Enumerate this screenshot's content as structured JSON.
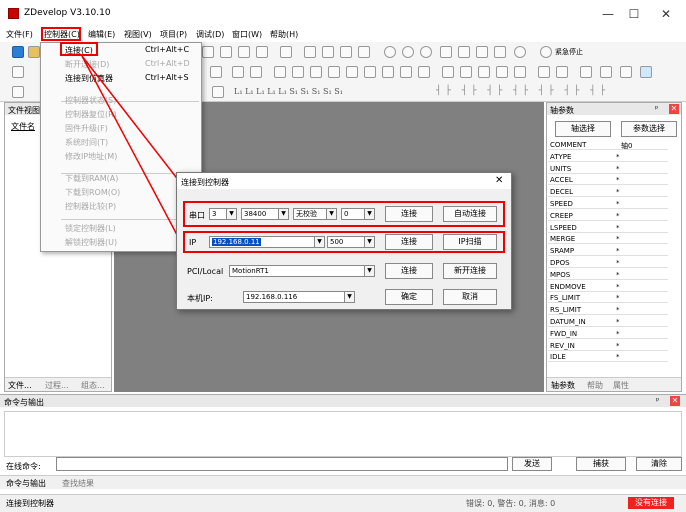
{
  "app": {
    "title": "ZDevelop V3.10.10"
  },
  "window_controls": {
    "minimize": "—",
    "maximize": "☐",
    "close": "✕"
  },
  "menubar": [
    {
      "label": "文件(F)"
    },
    {
      "label": "控制器(C)"
    },
    {
      "label": "编辑(E)"
    },
    {
      "label": "视图(V)"
    },
    {
      "label": "项目(P)"
    },
    {
      "label": "调试(D)"
    },
    {
      "label": "窗口(W)"
    },
    {
      "label": "帮助(H)"
    }
  ],
  "toolbar": {
    "emergency_stop": "紧急停止",
    "font_row": "L₁ L₁ L₁ L₁ L₁  S₁ S₁ S₁ S₁ S₁"
  },
  "controller_menu": {
    "items": [
      {
        "label": "连接(C)",
        "shortcut": "Ctrl+Alt+C",
        "enabled": true
      },
      {
        "label": "断开连接(D)",
        "shortcut": "Ctrl+Alt+D",
        "enabled": false
      },
      {
        "label": "连接到仿真器",
        "shortcut": "Ctrl+Alt+S",
        "enabled": true
      },
      {
        "label": "控制器状态(S)",
        "shortcut": "",
        "enabled": false
      },
      {
        "label": "控制器复位(R)",
        "shortcut": "",
        "enabled": false
      },
      {
        "label": "固件升级(F)",
        "shortcut": "",
        "enabled": false
      },
      {
        "label": "系统时间(T)",
        "shortcut": "",
        "enabled": false
      },
      {
        "label": "修改IP地址(M)",
        "shortcut": "",
        "enabled": false
      },
      {
        "label": "下载到RAM(A)",
        "shortcut": "",
        "enabled": false
      },
      {
        "label": "下载到ROM(O)",
        "shortcut": "",
        "enabled": false
      },
      {
        "label": "控制器比较(P)",
        "shortcut": "",
        "enabled": false
      },
      {
        "label": "锁定控制器(L)",
        "shortcut": "",
        "enabled": false
      },
      {
        "label": "解锁控制器(U)",
        "shortcut": "",
        "enabled": false
      }
    ]
  },
  "left_panel": {
    "title": "文件视图",
    "column": "文件名",
    "tabs": [
      "文件...",
      "过程...",
      "组态..."
    ]
  },
  "right_panel": {
    "title": "轴参数",
    "pin": "ᵖ",
    "close": "✕",
    "buttons": [
      "轴选择",
      "参数选择"
    ],
    "column_header": "轴0",
    "rows": [
      {
        "name": "COMMENT",
        "value": ""
      },
      {
        "name": "ATYPE",
        "value": "*"
      },
      {
        "name": "UNITS",
        "value": "*"
      },
      {
        "name": "ACCEL",
        "value": "*"
      },
      {
        "name": "DECEL",
        "value": "*"
      },
      {
        "name": "SPEED",
        "value": "*"
      },
      {
        "name": "CREEP",
        "value": "*"
      },
      {
        "name": "LSPEED",
        "value": "*"
      },
      {
        "name": "MERGE",
        "value": "*"
      },
      {
        "name": "SRAMP",
        "value": "*"
      },
      {
        "name": "DPOS",
        "value": "*"
      },
      {
        "name": "MPOS",
        "value": "*"
      },
      {
        "name": "ENDMOVE",
        "value": "*"
      },
      {
        "name": "FS_LIMIT",
        "value": "*"
      },
      {
        "name": "RS_LIMIT",
        "value": "*"
      },
      {
        "name": "DATUM_IN",
        "value": "*"
      },
      {
        "name": "FWD_IN",
        "value": "*"
      },
      {
        "name": "REV_IN",
        "value": "*"
      },
      {
        "name": "IDLE",
        "value": "*"
      }
    ],
    "tabs": [
      "轴参数",
      "帮助",
      "属性"
    ]
  },
  "dialog": {
    "title": "连接到控制器",
    "close": "✕",
    "serial": {
      "label": "串口",
      "port": "3",
      "baud": "38400",
      "parity": "无校验",
      "stop": "0",
      "connect": "连接",
      "auto": "自动连接"
    },
    "ip": {
      "label": "IP",
      "address": "192.168.0.11",
      "port": "500",
      "connect": "连接",
      "scan": "IP扫描"
    },
    "pci": {
      "label": "PCI/Local",
      "device": "MotionRT1",
      "connect": "连接",
      "new": "新开连接"
    },
    "local_ip": {
      "label": "本机IP:",
      "address": "192.168.0.116",
      "ok": "确定",
      "cancel": "取消"
    }
  },
  "command_panel": {
    "title": "命令与输出",
    "pin": "ᵖ",
    "close": "✕",
    "online_label": "在线命令:",
    "send": "发送",
    "capture": "捕获",
    "clear": "清除",
    "tabs": [
      "命令与输出",
      "查找结果"
    ]
  },
  "status": {
    "text": "连接到控制器",
    "counts": "错误: 0, 警告: 0, 消息: 0",
    "state": "没有连接"
  }
}
